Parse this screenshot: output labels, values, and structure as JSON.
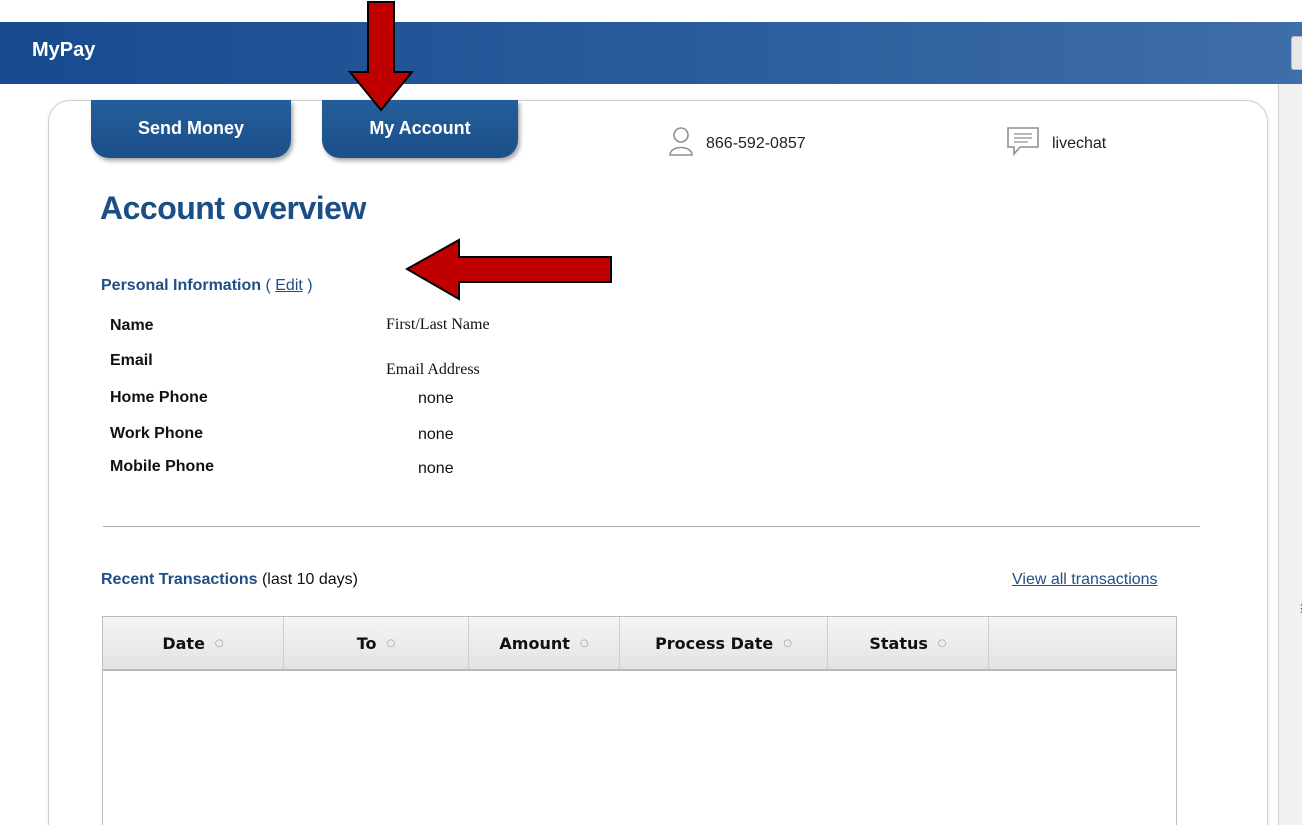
{
  "app": {
    "title": "MyPay"
  },
  "tabs": [
    {
      "label": "Send Money"
    },
    {
      "label": "My Account"
    }
  ],
  "contact": {
    "phone": "866-592-0857",
    "chat": "livechat",
    "icons": {
      "phone": "person-icon",
      "chat": "chat-bubble-icon"
    }
  },
  "page": {
    "heading": "Account overview"
  },
  "personal": {
    "title": "Personal Information",
    "edit_open": " ( ",
    "edit_label": "Edit",
    "edit_close": " )",
    "fields": [
      {
        "label": "Name",
        "value": "First/Last Name"
      },
      {
        "label": "Email",
        "value": "Email Address"
      },
      {
        "label": "Home Phone",
        "value": "none"
      },
      {
        "label": "Work Phone",
        "value": "none"
      },
      {
        "label": "Mobile Phone",
        "value": "none"
      }
    ]
  },
  "transactions": {
    "title": "Recent Transactions",
    "subtitle": " (last 10 days)",
    "view_all": "View all transactions",
    "columns": [
      "Date",
      "To",
      "Amount",
      "Process Date",
      "Status",
      ""
    ],
    "rows": []
  },
  "colors": {
    "title_bar": "#1e4f8f",
    "tab": "#1b4f89",
    "heading": "#1b4d87",
    "arrow": "#c00000"
  }
}
